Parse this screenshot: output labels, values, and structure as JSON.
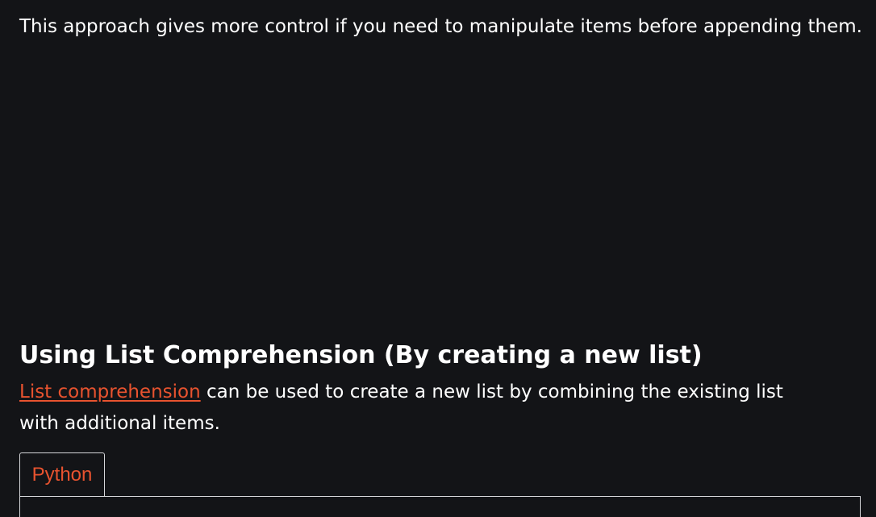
{
  "article": {
    "intro": "This approach gives more control if you need to manipulate items before appending them.",
    "section": {
      "heading": "Using List Comprehension (By creating a new list)",
      "link_text": "List comprehension",
      "paragraph_rest": " can be used to create a new list by combining the existing list with additional items."
    },
    "code_block": {
      "tabs": [
        "Python"
      ],
      "active_tab": "Python"
    }
  },
  "colors": {
    "background": "#131417",
    "text": "#ffffff",
    "accent": "#e8532f",
    "border": "#d6d7da"
  }
}
